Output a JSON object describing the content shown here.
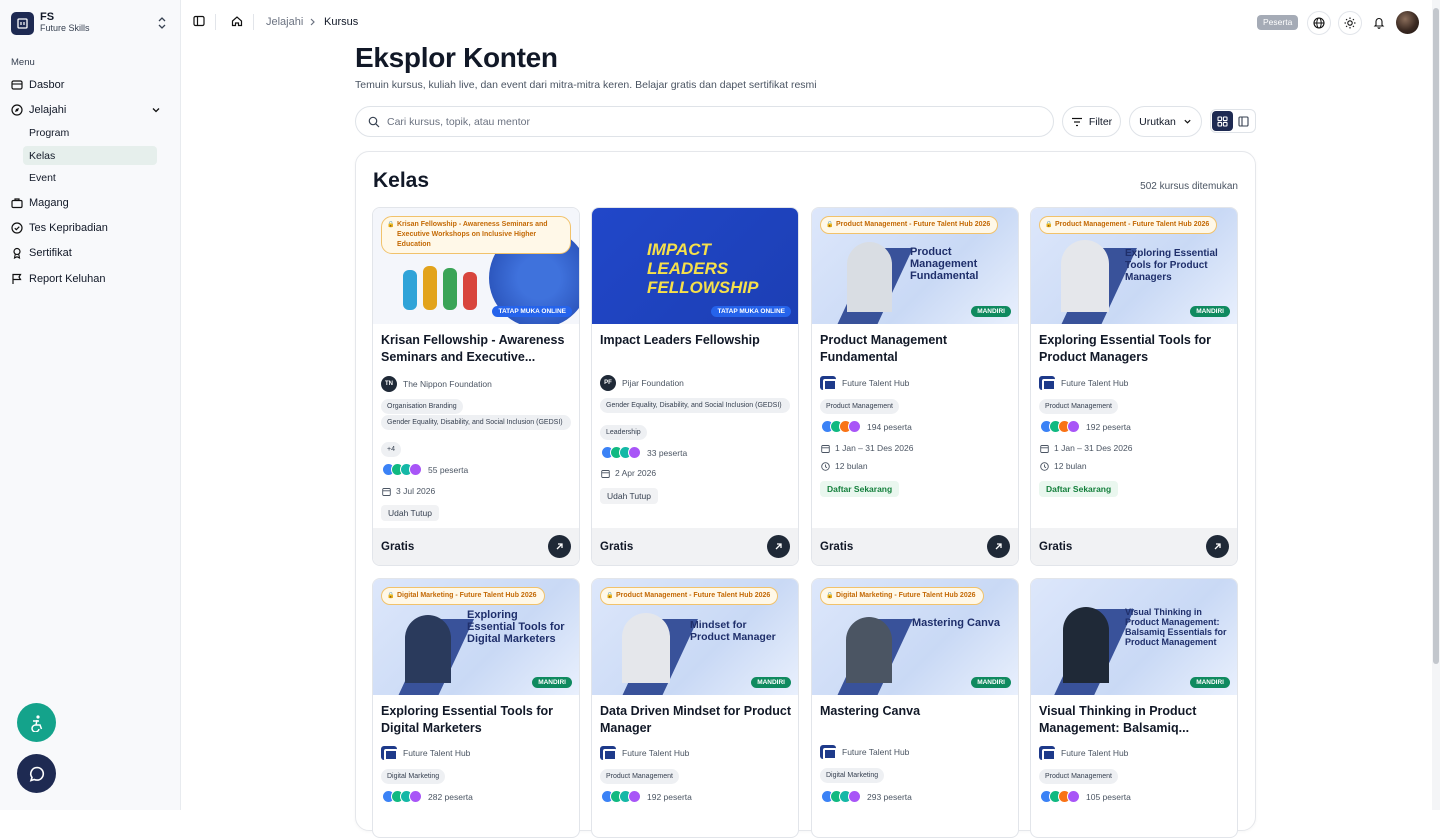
{
  "brand": {
    "abbr": "FS",
    "name": "Future Skills"
  },
  "sidebar": {
    "menu_heading": "Menu",
    "items": [
      {
        "label": "Dasbor"
      },
      {
        "label": "Jelajahi"
      },
      {
        "label": "Magang"
      },
      {
        "label": "Tes Kepribadian"
      },
      {
        "label": "Sertifikat"
      },
      {
        "label": "Report Keluhan"
      }
    ],
    "subitems": [
      {
        "label": "Program"
      },
      {
        "label": "Kelas"
      },
      {
        "label": "Event"
      }
    ]
  },
  "breadcrumb": {
    "parent": "Jelajahi",
    "current": "Kursus"
  },
  "user": {
    "role": "Peserta"
  },
  "page": {
    "title": "Eksplor Konten",
    "subtitle": "Temuin kursus, kuliah live, dan event dari mitra-mitra keren. Belajar gratis dan dapet sertifikat resmi",
    "search_placeholder": "Cari kursus, topik, atau mentor",
    "filter_label": "Filter",
    "sort_label": "Urutkan"
  },
  "section": {
    "title": "Kelas",
    "count": "502 kursus ditemukan"
  },
  "colors": {
    "navy": "#1e2a52",
    "teal": "#14a38b",
    "gold": "#c46a06",
    "green": "#0f8a5f"
  },
  "cards": [
    {
      "title": "Krisan Fellowship - Awareness Seminars and Executive...",
      "program": "Krisan Fellowship - Awareness Seminars and Executive Workshops on Inclusive Higher Education",
      "mode": "TATAP MUKA ONLINE",
      "org_abbr": "TN",
      "org": "The Nippon Foundation",
      "tags": [
        "Organisation Branding",
        "Gender Equality, Disability, and Social Inclusion (GEDSI)",
        "+4"
      ],
      "participants": "55 peserta",
      "date": "3 Jul 2026",
      "status": "Udah Tutup",
      "price": "Gratis"
    },
    {
      "title": "Impact Leaders Fellowship",
      "program": "",
      "cover_text": "IMPACT LEADERS FELLOWSHIP",
      "mode": "TATAP MUKA ONLINE",
      "org_abbr": "PF",
      "org": "Pijar Foundation",
      "tags": [
        "Gender Equality, Disability, and Social Inclusion (GEDSI)",
        "Leadership"
      ],
      "participants": "33 peserta",
      "date": "2 Apr 2026",
      "status": "Udah Tutup",
      "price": "Gratis"
    },
    {
      "title": "Product Management Fundamental",
      "program": "Product Management - Future Talent Hub 2026",
      "cover_text": "Product Management Fundamental",
      "mode": "MANDIRI",
      "org": "Future Talent Hub",
      "tags": [
        "Product Management"
      ],
      "participants": "194 peserta",
      "date": "1 Jan – 31 Des 2026",
      "duration": "12 bulan",
      "status": "Daftar Sekarang",
      "price": "Gratis"
    },
    {
      "title": "Exploring Essential Tools for Product Managers",
      "program": "Product Management - Future Talent Hub 2026",
      "cover_text": "Exploring Essential Tools for Product Managers",
      "mode": "MANDIRI",
      "org": "Future Talent Hub",
      "tags": [
        "Product Management"
      ],
      "participants": "192 peserta",
      "date": "1 Jan – 31 Des 2026",
      "duration": "12 bulan",
      "status": "Daftar Sekarang",
      "price": "Gratis"
    },
    {
      "title": "Exploring Essential Tools for Digital Marketers",
      "program": "Digital Marketing - Future Talent Hub 2026",
      "cover_text": "Exploring Essential Tools for Digital Marketers",
      "mode": "MANDIRI",
      "org": "Future Talent Hub",
      "tags": [
        "Digital Marketing"
      ],
      "participants": "282 peserta"
    },
    {
      "title": "Data Driven Mindset for Product Manager",
      "program": "Product Management - Future Talent Hub 2026",
      "cover_text": "Mindset for Product Manager",
      "mode": "MANDIRI",
      "org": "Future Talent Hub",
      "tags": [
        "Product Management"
      ],
      "participants": "192 peserta"
    },
    {
      "title": "Mastering Canva",
      "program": "Digital Marketing - Future Talent Hub 2026",
      "cover_text": "Mastering Canva",
      "mode": "MANDIRI",
      "org": "Future Talent Hub",
      "tags": [
        "Digital Marketing"
      ],
      "participants": "293 peserta"
    },
    {
      "title": "Visual Thinking in Product Management: Balsamiq...",
      "program": "",
      "cover_text": "Visual Thinking in Product Management: Balsamiq Essentials for Product Management",
      "mode": "MANDIRI",
      "org": "Future Talent Hub",
      "tags": [
        "Product Management"
      ],
      "participants": "105 peserta"
    }
  ]
}
